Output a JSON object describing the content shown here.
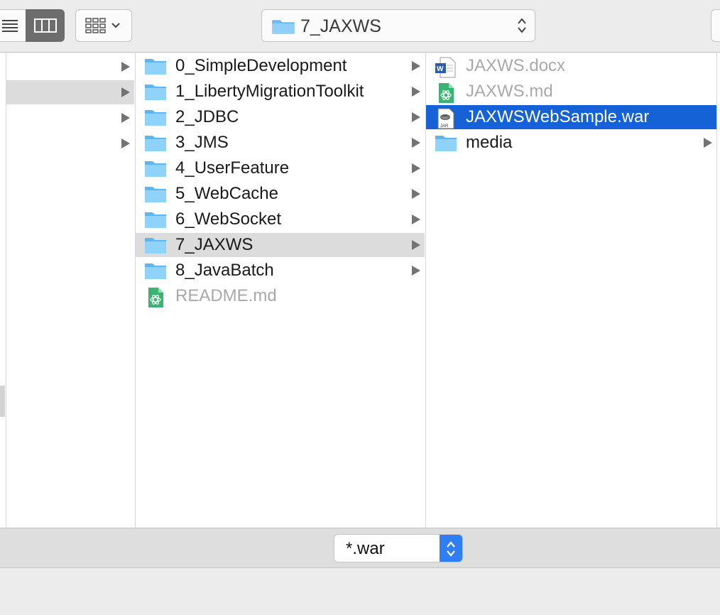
{
  "toolbar": {
    "path_title": "7_JAXWS",
    "view_modes": [
      "list-view-icon",
      "column-view-icon"
    ],
    "group_icon": "grid-group-icon"
  },
  "columns": [
    {
      "rows": [
        {
          "label": "",
          "selected": false,
          "arrow": true
        },
        {
          "label": "",
          "selected": true,
          "arrow": true
        },
        {
          "label": "",
          "selected": false,
          "arrow": true
        },
        {
          "label": "",
          "selected": false,
          "arrow": true
        }
      ]
    },
    {
      "rows": [
        {
          "label": "0_SimpleDevelopment",
          "type": "folder",
          "arrow": true
        },
        {
          "label": "1_LibertyMigrationToolkit",
          "type": "folder",
          "arrow": true
        },
        {
          "label": "2_JDBC",
          "type": "folder",
          "arrow": true
        },
        {
          "label": "3_JMS",
          "type": "folder",
          "arrow": true
        },
        {
          "label": "4_UserFeature",
          "type": "folder",
          "arrow": true
        },
        {
          "label": "5_WebCache",
          "type": "folder",
          "arrow": true
        },
        {
          "label": "6_WebSocket",
          "type": "folder",
          "arrow": true
        },
        {
          "label": "7_JAXWS",
          "type": "folder",
          "arrow": true,
          "selected": true
        },
        {
          "label": "8_JavaBatch",
          "type": "folder",
          "arrow": true
        },
        {
          "label": "README.md",
          "type": "md",
          "arrow": false,
          "disabled": true
        }
      ]
    },
    {
      "rows": [
        {
          "label": "JAXWS.docx",
          "type": "docx",
          "arrow": false,
          "disabled": true
        },
        {
          "label": "JAXWS.md",
          "type": "md",
          "arrow": false,
          "disabled": true
        },
        {
          "label": "JAXWSWebSample.war",
          "type": "jar",
          "arrow": false,
          "selected": true
        },
        {
          "label": "media",
          "type": "folder",
          "arrow": true
        }
      ]
    }
  ],
  "filter": {
    "value": "*.war"
  },
  "colors": {
    "selection_blue": "#1462d6",
    "folder_blue": "#6ec0f5"
  }
}
